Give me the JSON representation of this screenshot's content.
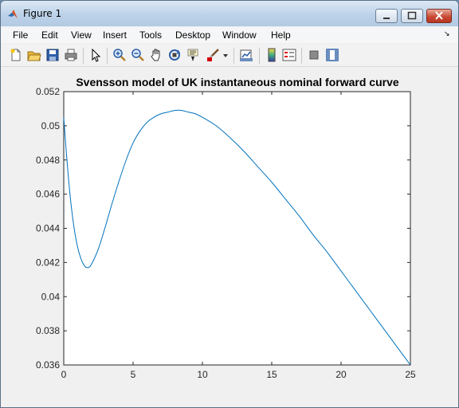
{
  "window": {
    "title": "Figure 1"
  },
  "menu": {
    "items": [
      "File",
      "Edit",
      "View",
      "Insert",
      "Tools",
      "Desktop",
      "Window",
      "Help"
    ]
  },
  "toolbar": {
    "icons": [
      "new-figure-icon",
      "open-file-icon",
      "save-icon",
      "print-icon",
      "edit-plot-arrow-icon",
      "zoom-in-icon",
      "zoom-out-icon",
      "pan-hand-icon",
      "rotate-3d-icon",
      "data-cursor-icon",
      "brush-icon",
      "brush-dropdown-icon",
      "link-plot-icon",
      "colorbar-icon",
      "legend-icon",
      "hide-plot-tools-icon",
      "show-plot-tools-icon"
    ]
  },
  "colors": {
    "line": "#0072bd",
    "axes_bg": "#ffffff",
    "figure_bg": "#f0f0f0"
  },
  "chart_data": {
    "type": "line",
    "title": "Svensson model of UK instantaneous nominal forward curve",
    "xlabel": "",
    "ylabel": "",
    "xlim": [
      0,
      25
    ],
    "ylim": [
      0.036,
      0.052
    ],
    "xticks": [
      0,
      5,
      10,
      15,
      20,
      25
    ],
    "xtick_labels": [
      "0",
      "5",
      "10",
      "15",
      "20",
      "25"
    ],
    "yticks": [
      0.036,
      0.038,
      0.04,
      0.042,
      0.044,
      0.046,
      0.048,
      0.05,
      0.052
    ],
    "ytick_labels": [
      "0.036",
      "0.038",
      "0.04",
      "0.042",
      "0.044",
      "0.046",
      "0.048",
      "0.05",
      "0.052"
    ],
    "grid": false,
    "series": [
      {
        "x": [
          0,
          0.25,
          0.5,
          0.75,
          1.0,
          1.25,
          1.5,
          1.75,
          2.0,
          2.5,
          3.0,
          3.5,
          4.0,
          4.5,
          5.0,
          5.5,
          6.0,
          6.5,
          7.0,
          7.5,
          8.0,
          8.5,
          9.0,
          9.5,
          10.0,
          11.0,
          12.0,
          13.0,
          14.0,
          15.0,
          16.0,
          17.0,
          18.0,
          19.0,
          20.0,
          21.0,
          22.0,
          23.0,
          24.0,
          25.0
        ],
        "y": [
          0.0505,
          0.0478,
          0.0456,
          0.044,
          0.0429,
          0.0422,
          0.0418,
          0.0417,
          0.0419,
          0.0428,
          0.0441,
          0.0455,
          0.0468,
          0.048,
          0.049,
          0.0497,
          0.0502,
          0.0505,
          0.0507,
          0.0508,
          0.0509,
          0.0509,
          0.0508,
          0.0507,
          0.0505,
          0.05,
          0.0493,
          0.0485,
          0.0476,
          0.0467,
          0.0457,
          0.0447,
          0.0436,
          0.0426,
          0.0415,
          0.0404,
          0.0393,
          0.0382,
          0.0371,
          0.036
        ]
      }
    ]
  }
}
